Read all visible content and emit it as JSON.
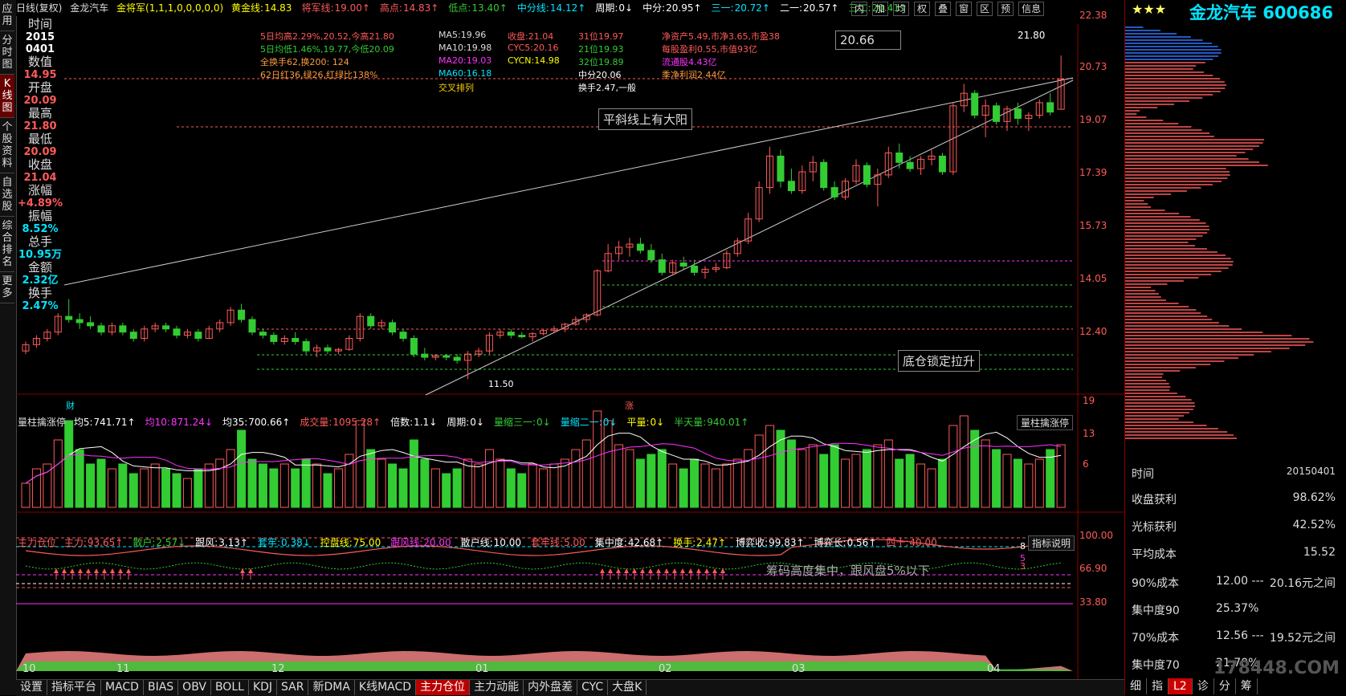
{
  "colors": {
    "up": "#ff5a5a",
    "down": "#33cc33",
    "flat": "#ffffff",
    "accent": "#ffcc00",
    "cyan": "#00e5ff",
    "magenta": "#ff33ff"
  },
  "leftbar": {
    "tabs": [
      {
        "label": "应用"
      },
      {
        "label": "分时图"
      },
      {
        "label": "K线图",
        "active": true
      },
      {
        "label": "个股资料"
      },
      {
        "label": "自选股"
      },
      {
        "label": "综合排名"
      },
      {
        "label": "更多"
      }
    ]
  },
  "topbar": {
    "period": "日线(复权)",
    "stock": "金龙汽车",
    "indicator": "金将军(1,1,1,0,0,0,0,0)",
    "items": [
      {
        "label": "黄金线:",
        "value": "14.83",
        "color": "#ffff00"
      },
      {
        "label": "将军线:",
        "value": "19.00↑",
        "color": "#ff5a5a"
      },
      {
        "label": "高点:",
        "value": "14.83↑",
        "color": "#ff5a5a"
      },
      {
        "label": "低点:",
        "value": "13.40↑",
        "color": "#33cc33"
      },
      {
        "label": "中分线:",
        "value": "14.12↑",
        "color": "#00e5ff"
      },
      {
        "label": "周期:",
        "value": "0↓",
        "color": "#ffffff"
      },
      {
        "label": "中分:",
        "value": "20.95↑",
        "color": "#ffffff"
      },
      {
        "label": "三一:",
        "value": "20.72↑",
        "color": "#00e5ff"
      },
      {
        "label": "二一:",
        "value": "20.57↑",
        "color": "#ffffff"
      },
      {
        "label": "三二:",
        "value": "20.41↑",
        "color": "#33cc33"
      }
    ],
    "buttons": [
      "内",
      "加",
      "均",
      "权",
      "叠",
      "窗",
      "区",
      "预",
      "信息"
    ]
  },
  "info": {
    "time_label": "时间",
    "date": "2015",
    "date2": "0401",
    "value_label": "数值",
    "value": "14.95",
    "open_label": "开盘",
    "open": "20.09",
    "high_label": "最高",
    "high": "21.80",
    "low_label": "最低",
    "low": "20.09",
    "close_label": "收盘",
    "close": "21.04",
    "chg_label": "涨幅",
    "chg": "+4.89%",
    "amp_label": "振幅",
    "amp": "8.52%",
    "vol_label": "总手",
    "vol": "10.95万",
    "amt_label": "金额",
    "amt": "2.32亿",
    "turn_label": "换手",
    "turn": "2.47%"
  },
  "stats": {
    "col1": [
      "5日均高2.29%,20.52,今高21.80",
      "5日均低1.46%,19.77,今低20.09",
      "全换手62,换200: 124",
      "62日红36,绿26,红绿比138%"
    ],
    "col2": [
      "MA5:19.96",
      "MA10:19.98",
      "MA20:19.03",
      "MA60:16.18",
      "交叉排列"
    ],
    "col3": [
      "收盘:21.04",
      "CYC5:20.16",
      "CYCN:14.98"
    ],
    "col4": [
      "31位19.97",
      "21位19.93",
      "32位19.89",
      "中分20.06",
      "换手2.47,一般"
    ],
    "col5": [
      "净资产5.49,市净3.65,市盈38",
      "每股盈利0.55,市值93亿",
      "流通股4.43亿",
      "季净利润2.44亿"
    ]
  },
  "annotations": {
    "a1": "20.66",
    "a2": "平斜线上有大阳",
    "a3": "底仓锁定拉升",
    "a4": "筹码高度集中，跟风盘5%以下",
    "high_mark": "21.80",
    "low_mark": "11.50",
    "cai": "财",
    "zhang": "涨"
  },
  "y_axis": [
    "22.38",
    "20.73",
    "19.07",
    "17.39",
    "15.73",
    "14.05",
    "12.40"
  ],
  "vol_panel": {
    "title": "量柱擒涨停",
    "items": [
      {
        "label": "均5:",
        "value": "741.71↑",
        "color": "#ffffff"
      },
      {
        "label": "均10:",
        "value": "871.24↓",
        "color": "#ff33ff"
      },
      {
        "label": "均35:",
        "value": "700.66↑",
        "color": "#ffffff"
      },
      {
        "label": "成交量:",
        "value": "1095.28↑",
        "color": "#ff5a5a"
      },
      {
        "label": "倍数:",
        "value": "1.1↓",
        "color": "#ffffff"
      },
      {
        "label": "周期:",
        "value": "0↓",
        "color": "#ffffff"
      },
      {
        "label": "量缩三一:",
        "value": "0↓",
        "color": "#33cc33"
      },
      {
        "label": "量缩二一:",
        "value": "0↓",
        "color": "#00e5ff"
      },
      {
        "label": "平量:",
        "value": "0↓",
        "color": "#ffff00"
      },
      {
        "label": "半天量:",
        "value": "940.01↑",
        "color": "#33cc33"
      }
    ],
    "btn": "量柱擒涨停",
    "axis": [
      "19",
      "13",
      "6"
    ]
  },
  "ind_panel": {
    "title": "主力仓位",
    "items": [
      {
        "label": "主力:",
        "value": "93.65↑",
        "color": "#ff5a5a"
      },
      {
        "label": "散户:",
        "value": "2.57↓",
        "color": "#33cc33"
      },
      {
        "label": "跟风:",
        "value": "3.13↑",
        "color": "#ffffff"
      },
      {
        "label": "套牢:",
        "value": "0.38↓",
        "color": "#00e5ff"
      },
      {
        "label": "控盘线:",
        "value": "75.00",
        "color": "#ffff00"
      },
      {
        "label": "跟风线:",
        "value": "20.00",
        "color": "#ff33ff"
      },
      {
        "label": "散户线:",
        "value": "10.00",
        "color": "#ffffff"
      },
      {
        "label": "套牢线:",
        "value": "5.00",
        "color": "#ff5a5a"
      },
      {
        "label": "集中度:",
        "value": "42.68↑",
        "color": "#ffffff"
      },
      {
        "label": "换手:",
        "value": "2.47↑",
        "color": "#ffff00"
      },
      {
        "label": "博弈收:",
        "value": "99.83↑",
        "color": "#ffffff"
      },
      {
        "label": "博弈长:",
        "value": "0.56↑",
        "color": "#ffffff"
      },
      {
        "label": "四十:",
        "value": "40.00",
        "color": "#ff5a5a"
      }
    ],
    "btn": "指标说明",
    "axis": [
      "100.00",
      "66.90",
      "33.80"
    ],
    "marks": [
      "8",
      "5",
      "3"
    ]
  },
  "x_axis": [
    "10",
    "11",
    "12",
    "01",
    "02",
    "03",
    "04"
  ],
  "bottom_tabs": [
    "设置",
    "指标平台",
    "MACD",
    "BIAS",
    "OBV",
    "BOLL",
    "KDJ",
    "SAR",
    "新DMA",
    "K线MACD",
    "主力仓位",
    "主力动能",
    "内外盘差",
    "CYC",
    "大盘K"
  ],
  "bottom_active": "主力仓位",
  "right": {
    "stars": "★★★",
    "title": "金龙汽车 600686",
    "rows": [
      {
        "label": "时间",
        "value": "20150401"
      },
      {
        "label": "收盘获利",
        "value": "98.62%"
      },
      {
        "label": "光标获利",
        "value": "42.52%"
      },
      {
        "label": "平均成本",
        "value": "15.52"
      }
    ],
    "rows2": [
      {
        "label": "90%成本",
        "mid": "12.00 ---",
        "value": "20.16元之间"
      },
      {
        "label": "集中度90",
        "mid": "25.37%",
        "value": ""
      },
      {
        "label": "70%成本",
        "mid": "12.56 ---",
        "value": "19.52元之间"
      },
      {
        "label": "集中度70",
        "mid": "21.70%",
        "value": ""
      }
    ],
    "tabs": [
      "细",
      "指",
      "L2",
      "诊",
      "分",
      "筹"
    ],
    "active_tab": "L2",
    "watermark": "178448.COM"
  },
  "chart_data": {
    "type": "candlestick",
    "y_range": [
      11.0,
      22.8
    ],
    "x_labels": [
      "10",
      "11",
      "12",
      "01",
      "02",
      "03",
      "04"
    ],
    "candles": [
      [
        12.4,
        12.7,
        12.3,
        12.6
      ],
      [
        12.6,
        12.9,
        12.5,
        12.8
      ],
      [
        12.8,
        13.1,
        12.7,
        13.0
      ],
      [
        13.0,
        13.6,
        12.9,
        13.5
      ],
      [
        13.5,
        14.05,
        13.3,
        13.4
      ],
      [
        13.4,
        13.6,
        13.1,
        13.3
      ],
      [
        13.3,
        13.5,
        13.1,
        13.2
      ],
      [
        13.2,
        13.3,
        12.9,
        13.0
      ],
      [
        13.0,
        13.3,
        12.9,
        13.2
      ],
      [
        13.2,
        13.3,
        12.9,
        13.0
      ],
      [
        13.0,
        13.1,
        12.7,
        12.8
      ],
      [
        12.8,
        13.2,
        12.7,
        13.1
      ],
      [
        13.1,
        13.3,
        13.0,
        13.2
      ],
      [
        13.2,
        13.3,
        13.0,
        13.1
      ],
      [
        13.1,
        13.2,
        12.8,
        12.9
      ],
      [
        12.9,
        13.1,
        12.8,
        13.0
      ],
      [
        13.0,
        13.1,
        12.7,
        12.8
      ],
      [
        12.8,
        13.2,
        12.8,
        13.1
      ],
      [
        13.1,
        13.4,
        13.0,
        13.3
      ],
      [
        13.3,
        13.8,
        13.2,
        13.7
      ],
      [
        13.7,
        13.9,
        13.3,
        13.4
      ],
      [
        13.4,
        13.5,
        12.9,
        13.0
      ],
      [
        13.0,
        13.1,
        12.8,
        12.9
      ],
      [
        12.9,
        13.0,
        12.6,
        12.7
      ],
      [
        12.7,
        12.9,
        12.6,
        12.8
      ],
      [
        12.8,
        13.0,
        12.6,
        12.7
      ],
      [
        12.7,
        12.8,
        12.3,
        12.4
      ],
      [
        12.4,
        12.6,
        12.2,
        12.5
      ],
      [
        12.5,
        12.6,
        12.3,
        12.4
      ],
      [
        12.4,
        12.5,
        12.3,
        12.45
      ],
      [
        12.45,
        12.9,
        12.4,
        12.8
      ],
      [
        12.8,
        13.6,
        12.7,
        13.5
      ],
      [
        13.5,
        13.6,
        13.1,
        13.2
      ],
      [
        13.2,
        13.4,
        13.1,
        13.3
      ],
      [
        13.3,
        13.4,
        12.9,
        13.0
      ],
      [
        13.0,
        13.1,
        12.7,
        12.8
      ],
      [
        12.8,
        12.9,
        12.2,
        12.3
      ],
      [
        12.3,
        12.5,
        12.1,
        12.2
      ],
      [
        12.2,
        12.3,
        12.1,
        12.25
      ],
      [
        12.25,
        12.3,
        12.1,
        12.2
      ],
      [
        12.2,
        12.3,
        12.0,
        12.1
      ],
      [
        12.1,
        12.4,
        11.5,
        12.3
      ],
      [
        12.3,
        12.5,
        12.2,
        12.4
      ],
      [
        12.4,
        13.0,
        12.3,
        12.9
      ],
      [
        12.9,
        13.1,
        12.8,
        13.0
      ],
      [
        13.0,
        13.1,
        12.8,
        12.9
      ],
      [
        12.9,
        13.0,
        12.8,
        12.85
      ],
      [
        12.85,
        13.0,
        12.7,
        12.95
      ],
      [
        12.95,
        13.1,
        12.9,
        13.05
      ],
      [
        13.05,
        13.2,
        13.0,
        13.1
      ],
      [
        13.1,
        13.3,
        13.0,
        13.25
      ],
      [
        13.25,
        13.5,
        13.2,
        13.4
      ],
      [
        13.4,
        13.6,
        13.3,
        13.55
      ],
      [
        13.55,
        15.0,
        13.5,
        14.95
      ],
      [
        14.95,
        15.8,
        14.9,
        15.5
      ],
      [
        15.5,
        15.9,
        15.3,
        15.7
      ],
      [
        15.7,
        16.0,
        15.4,
        15.8
      ],
      [
        15.8,
        16.0,
        15.5,
        15.6
      ],
      [
        15.6,
        15.8,
        15.2,
        15.3
      ],
      [
        15.3,
        15.5,
        14.8,
        14.9
      ],
      [
        14.9,
        15.3,
        14.8,
        15.2
      ],
      [
        15.2,
        15.4,
        15.0,
        15.1
      ],
      [
        15.1,
        15.3,
        14.8,
        14.9
      ],
      [
        14.9,
        15.1,
        14.7,
        15.0
      ],
      [
        15.0,
        15.2,
        14.9,
        15.05
      ],
      [
        15.05,
        15.6,
        15.0,
        15.5
      ],
      [
        15.5,
        16.0,
        15.4,
        15.9
      ],
      [
        15.9,
        16.8,
        15.8,
        16.6
      ],
      [
        16.6,
        17.8,
        16.5,
        17.6
      ],
      [
        17.6,
        18.9,
        17.4,
        18.6
      ],
      [
        18.6,
        18.8,
        17.6,
        17.8
      ],
      [
        17.8,
        18.2,
        17.4,
        17.5
      ],
      [
        17.5,
        18.3,
        17.4,
        18.1
      ],
      [
        18.1,
        18.6,
        17.8,
        18.4
      ],
      [
        18.4,
        18.5,
        17.5,
        17.6
      ],
      [
        17.6,
        17.8,
        17.2,
        17.3
      ],
      [
        17.3,
        17.9,
        17.2,
        17.8
      ],
      [
        17.8,
        18.5,
        17.7,
        18.3
      ],
      [
        18.3,
        18.4,
        17.6,
        17.7
      ],
      [
        17.7,
        18.2,
        17.0,
        18.0
      ],
      [
        18.0,
        18.9,
        17.9,
        18.7
      ],
      [
        18.7,
        19.0,
        18.2,
        18.4
      ],
      [
        18.4,
        18.6,
        18.1,
        18.2
      ],
      [
        18.2,
        18.6,
        18.0,
        18.5
      ],
      [
        18.5,
        18.8,
        18.3,
        18.6
      ],
      [
        18.6,
        18.7,
        18.0,
        18.1
      ],
      [
        18.1,
        20.3,
        18.0,
        20.2
      ],
      [
        20.2,
        20.9,
        20.0,
        20.6
      ],
      [
        20.6,
        20.7,
        19.8,
        19.9
      ],
      [
        19.9,
        20.4,
        19.2,
        20.2
      ],
      [
        20.2,
        20.3,
        19.6,
        19.7
      ],
      [
        19.7,
        20.2,
        19.4,
        20.1
      ],
      [
        20.1,
        20.3,
        19.6,
        19.8
      ],
      [
        19.8,
        20.0,
        19.4,
        19.9
      ],
      [
        19.9,
        20.4,
        19.8,
        20.3
      ],
      [
        20.3,
        20.6,
        19.9,
        20.0
      ],
      [
        20.09,
        21.8,
        20.09,
        21.04
      ]
    ],
    "volumes": [
      5,
      8,
      9,
      14,
      18,
      12,
      9,
      10,
      8,
      9,
      7,
      8,
      9,
      8,
      7,
      6,
      8,
      9,
      10,
      12,
      16,
      10,
      9,
      8,
      9,
      8,
      10,
      9,
      7,
      8,
      11,
      18,
      12,
      10,
      9,
      8,
      14,
      10,
      8,
      7,
      8,
      10,
      9,
      12,
      10,
      8,
      7,
      9,
      8,
      9,
      10,
      12,
      14,
      20,
      18,
      13,
      12,
      10,
      11,
      12,
      9,
      8,
      10,
      9,
      8,
      9,
      10,
      12,
      15,
      17,
      16,
      14,
      12,
      13,
      11,
      13,
      10,
      11,
      12,
      13,
      14,
      10,
      11,
      9,
      8,
      10,
      17,
      19,
      16,
      14,
      12,
      11,
      10,
      9,
      10,
      12,
      13
    ]
  }
}
